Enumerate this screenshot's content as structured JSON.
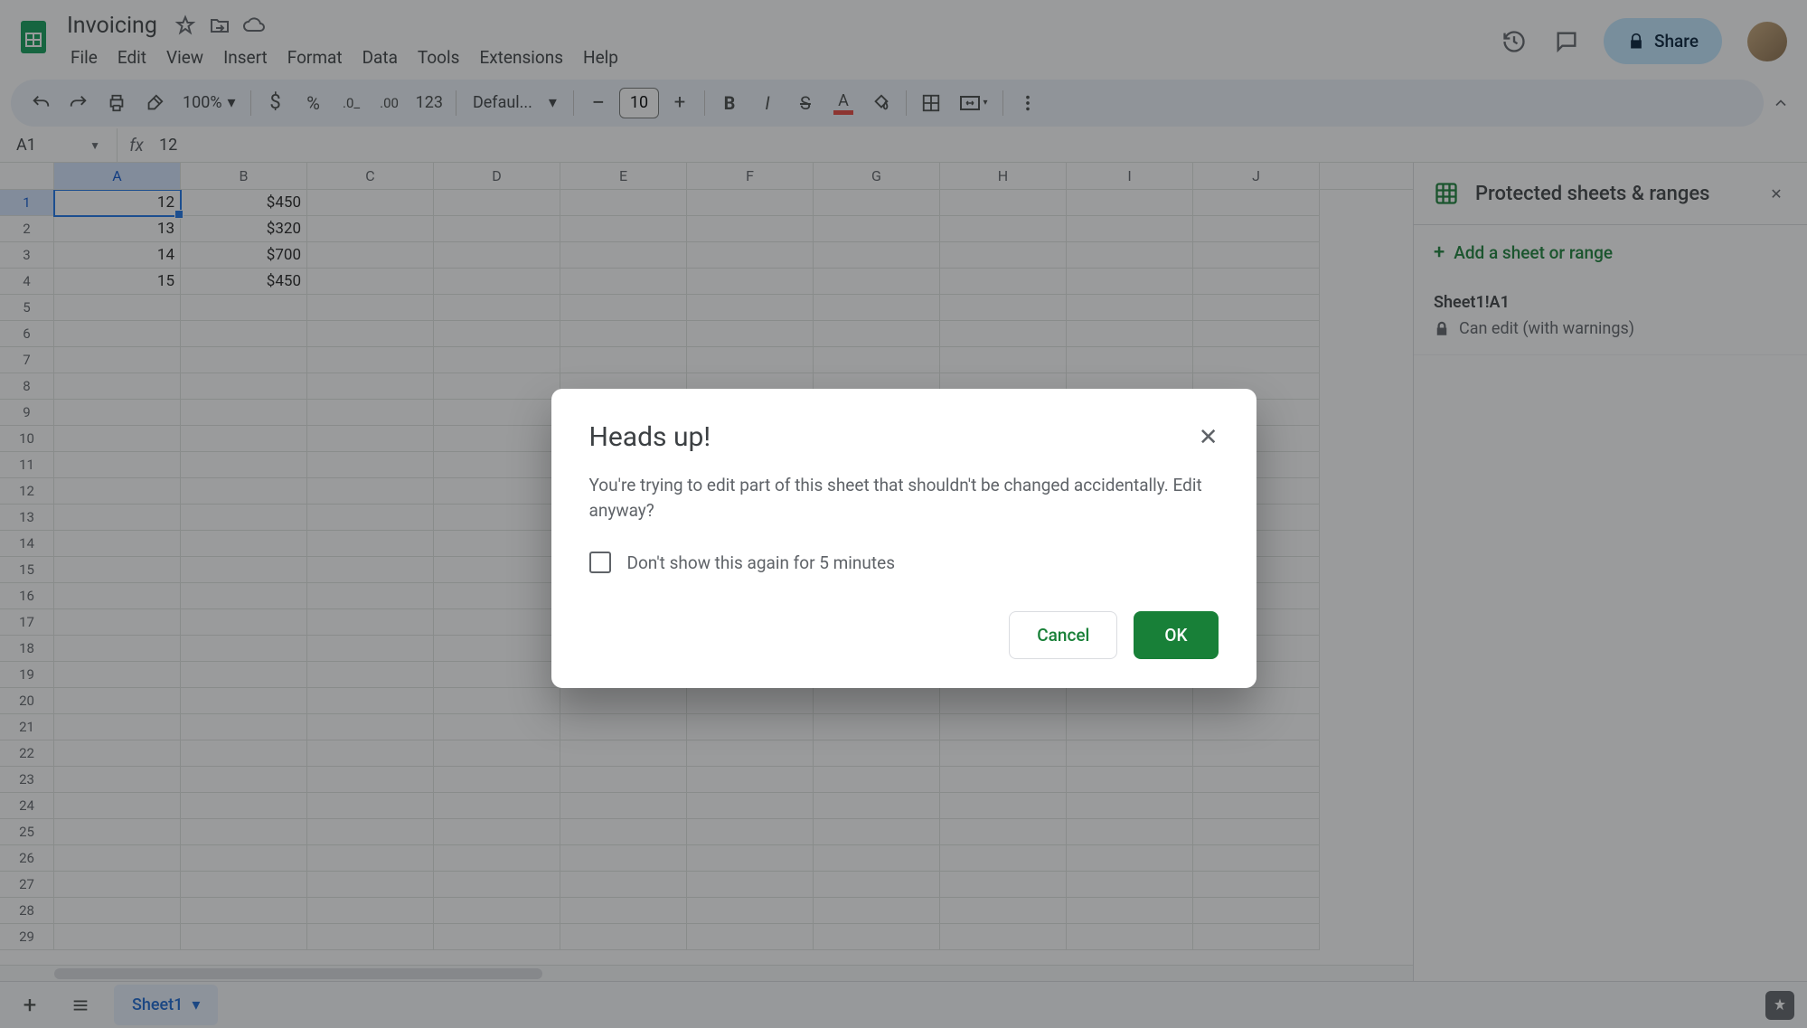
{
  "document": {
    "title": "Invoicing"
  },
  "menu": [
    "File",
    "Edit",
    "View",
    "Insert",
    "Format",
    "Data",
    "Tools",
    "Extensions",
    "Help"
  ],
  "share_label": "Share",
  "toolbar": {
    "zoom": "100%",
    "font_format_label": "Defaul...",
    "font_size": "10",
    "number_format": "123"
  },
  "name_box": "A1",
  "formula": "12",
  "columns": [
    "A",
    "B",
    "C",
    "D",
    "E",
    "F",
    "G",
    "H",
    "I",
    "J"
  ],
  "row_count": 29,
  "cells": {
    "A1": "12",
    "B1": "$450",
    "A2": "13",
    "B2": "$320",
    "A3": "14",
    "B3": "$700",
    "A4": "15",
    "B4": "$450"
  },
  "panel": {
    "title": "Protected sheets & ranges",
    "add_label": "Add a sheet or range",
    "range_ref": "Sheet1!A1",
    "range_perm": "Can edit (with warnings)"
  },
  "sheet_tab": "Sheet1",
  "dialog": {
    "title": "Heads up!",
    "body": "You're trying to edit part of this sheet that shouldn't be changed accidentally. Edit anyway?",
    "checkbox_label": "Don't show this again for 5 minutes",
    "cancel": "Cancel",
    "ok": "OK"
  }
}
